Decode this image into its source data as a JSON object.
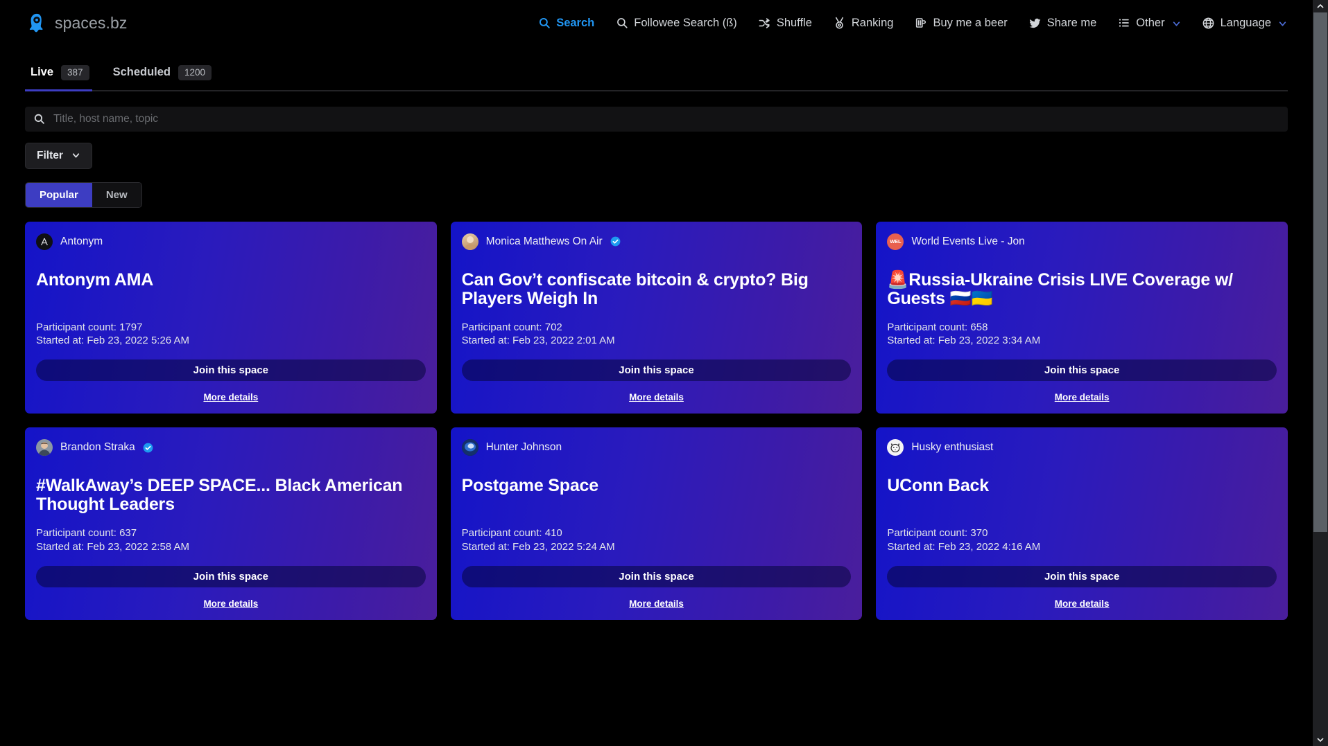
{
  "brand": {
    "name": "spaces.bz",
    "logo_icon": "rocket-logo-icon",
    "accent": "#2196f3"
  },
  "nav": {
    "items": [
      {
        "label": "Search",
        "icon": "search-icon",
        "active": true
      },
      {
        "label": "Followee Search (ß)",
        "icon": "search-icon",
        "active": false
      },
      {
        "label": "Shuffle",
        "icon": "shuffle-icon",
        "active": false
      },
      {
        "label": "Ranking",
        "icon": "medal-icon",
        "active": false
      },
      {
        "label": "Buy me a beer",
        "icon": "beer-mug-icon",
        "active": false
      },
      {
        "label": "Share me",
        "icon": "twitter-bird-icon",
        "active": false
      },
      {
        "label": "Other",
        "icon": "list-icon",
        "active": false,
        "chevron": true
      },
      {
        "label": "Language",
        "icon": "globe-icon",
        "active": false,
        "chevron": true
      }
    ]
  },
  "tabs": [
    {
      "label": "Live",
      "count": "387",
      "active": true
    },
    {
      "label": "Scheduled",
      "count": "1200",
      "active": false
    }
  ],
  "search": {
    "placeholder": "Title, host name, topic",
    "value": "",
    "icon": "search-icon"
  },
  "filter": {
    "label": "Filter",
    "chevron_icon": "chevron-down-icon"
  },
  "sort": {
    "options": [
      {
        "label": "Popular",
        "active": true
      },
      {
        "label": "New",
        "active": false
      }
    ],
    "active_color": "#3d3dc2"
  },
  "card_labels": {
    "join": "Join this space",
    "more": "More details",
    "participant_prefix": "Participant count: ",
    "started_prefix": "Started at: "
  },
  "cards": [
    {
      "host": "Antonym",
      "verified": false,
      "avatar_initials": "A",
      "avatar_bg": "#0f0f14",
      "title": "Antonym AMA",
      "participant_count": "1797",
      "started_at": "Feb 23, 2022 5:26 AM",
      "participant_line": "Participant count: 1797",
      "started_line": "Started at: Feb 23, 2022 5:26 AM"
    },
    {
      "host": "Monica Matthews On Air",
      "verified": true,
      "avatar_initials": "",
      "avatar_bg": "#d8b78c",
      "title": "Can Gov’t confiscate bitcoin & crypto? Big Players Weigh In",
      "participant_count": "702",
      "started_at": "Feb 23, 2022 2:01 AM",
      "participant_line": "Participant count: 702",
      "started_line": "Started at: Feb 23, 2022 2:01 AM"
    },
    {
      "host": "World Events Live - Jon",
      "verified": false,
      "avatar_initials": "WEL",
      "avatar_bg": "#e8604f",
      "title": "🚨Russia-Ukraine Crisis LIVE Coverage w/ Guests 🇷🇺🇺🇦",
      "participant_count": "658",
      "started_at": "Feb 23, 2022 3:34 AM",
      "participant_line": "Participant count: 658",
      "started_line": "Started at: Feb 23, 2022 3:34 AM"
    },
    {
      "host": "Brandon Straka",
      "verified": true,
      "avatar_initials": "",
      "avatar_bg": "#6d7b88",
      "title": "#WalkAway’s DEEP SPACE... Black American Thought Leaders",
      "participant_count": "637",
      "started_at": "Feb 23, 2022 2:58 AM",
      "participant_line": "Participant count: 637",
      "started_line": "Started at: Feb 23, 2022 2:58 AM"
    },
    {
      "host": "Hunter Johnson",
      "verified": false,
      "avatar_initials": "",
      "avatar_bg": "#2d4f8f",
      "title": "Postgame Space",
      "participant_count": "410",
      "started_at": "Feb 23, 2022 5:24 AM",
      "participant_line": "Participant count: 410",
      "started_line": "Started at: Feb 23, 2022 5:24 AM"
    },
    {
      "host": "Husky enthusiast",
      "verified": false,
      "avatar_initials": "",
      "avatar_bg": "#f2f2f2",
      "title": "UConn Back",
      "participant_count": "370",
      "started_at": "Feb 23, 2022 4:16 AM",
      "participant_line": "Participant count: 370",
      "started_line": "Started at: Feb 23, 2022 4:16 AM"
    }
  ]
}
